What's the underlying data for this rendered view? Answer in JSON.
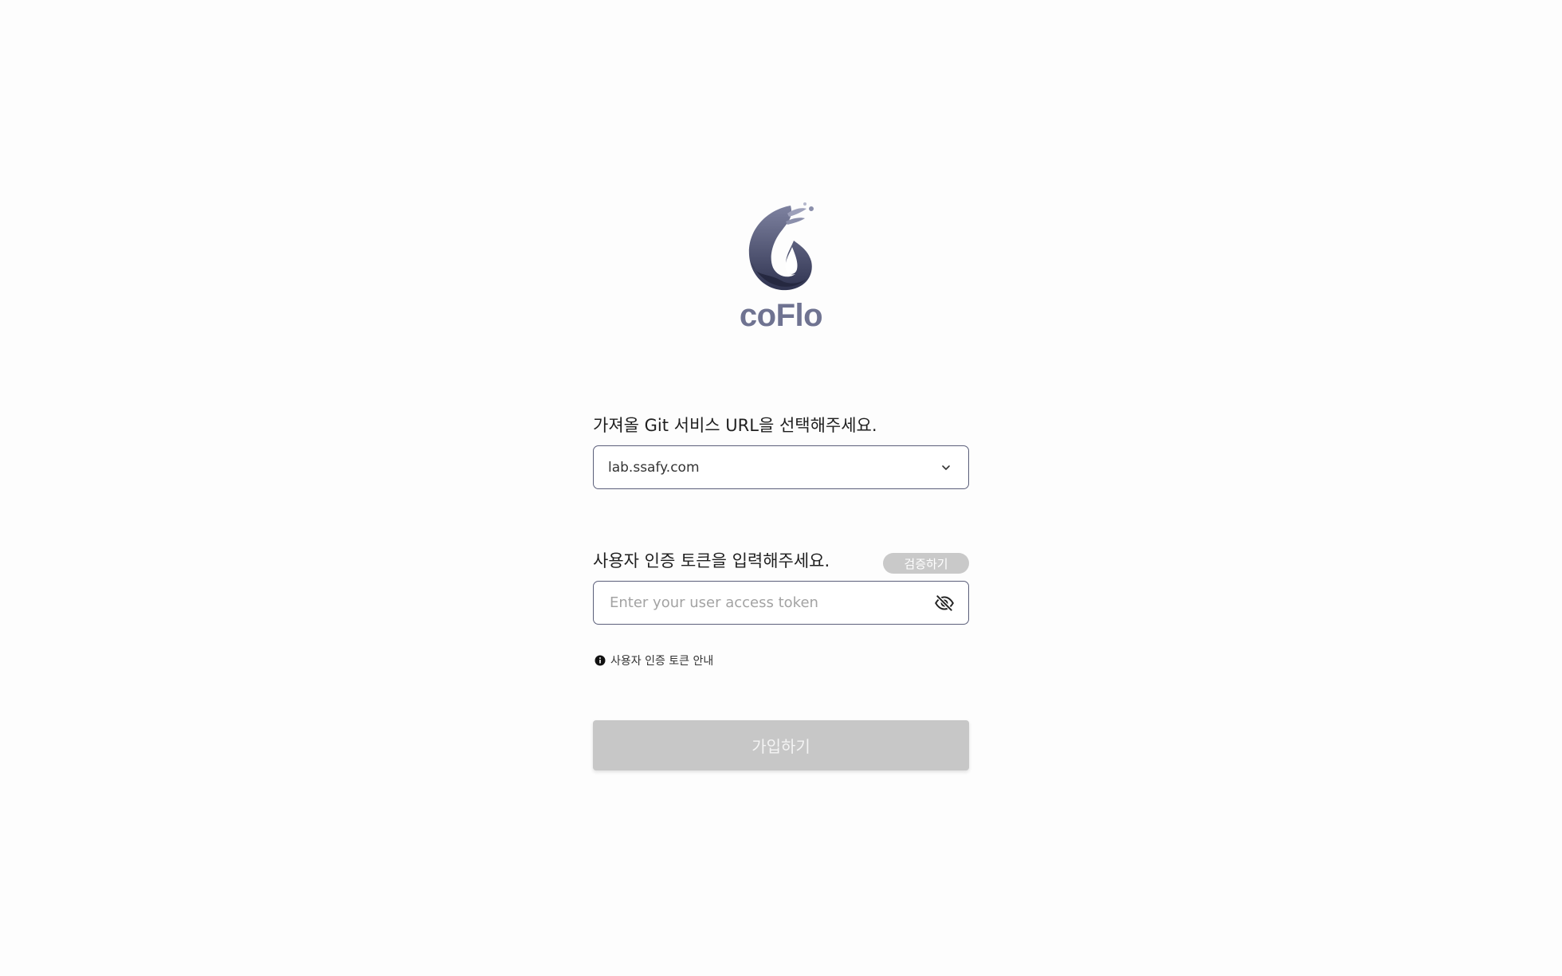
{
  "brand": {
    "name": "coFlo",
    "logo_icon": "water-drop-splash-logo",
    "logo_colors": [
      "#2f3350",
      "#6f7391"
    ]
  },
  "git_service": {
    "label": "가져올 Git 서비스 URL을 선택해주세요.",
    "selected_value": "lab.ssafy.com",
    "dropdown_icon": "chevron-down-icon"
  },
  "token": {
    "label": "사용자 인증 토큰을 입력해주세요.",
    "verify_button": "검증하기",
    "placeholder": "Enter your user access token",
    "value": "",
    "visibility_icon": "eye-off-icon"
  },
  "help": {
    "icon": "info-icon",
    "text": "사용자 인증 토큰 안내"
  },
  "submit": {
    "label": "가입하기",
    "disabled": true
  },
  "colors": {
    "accent": "#5b5f7a",
    "brand_text": "#6f7391",
    "disabled_button": "#c7c7c7",
    "background": "#fdfdfd"
  }
}
